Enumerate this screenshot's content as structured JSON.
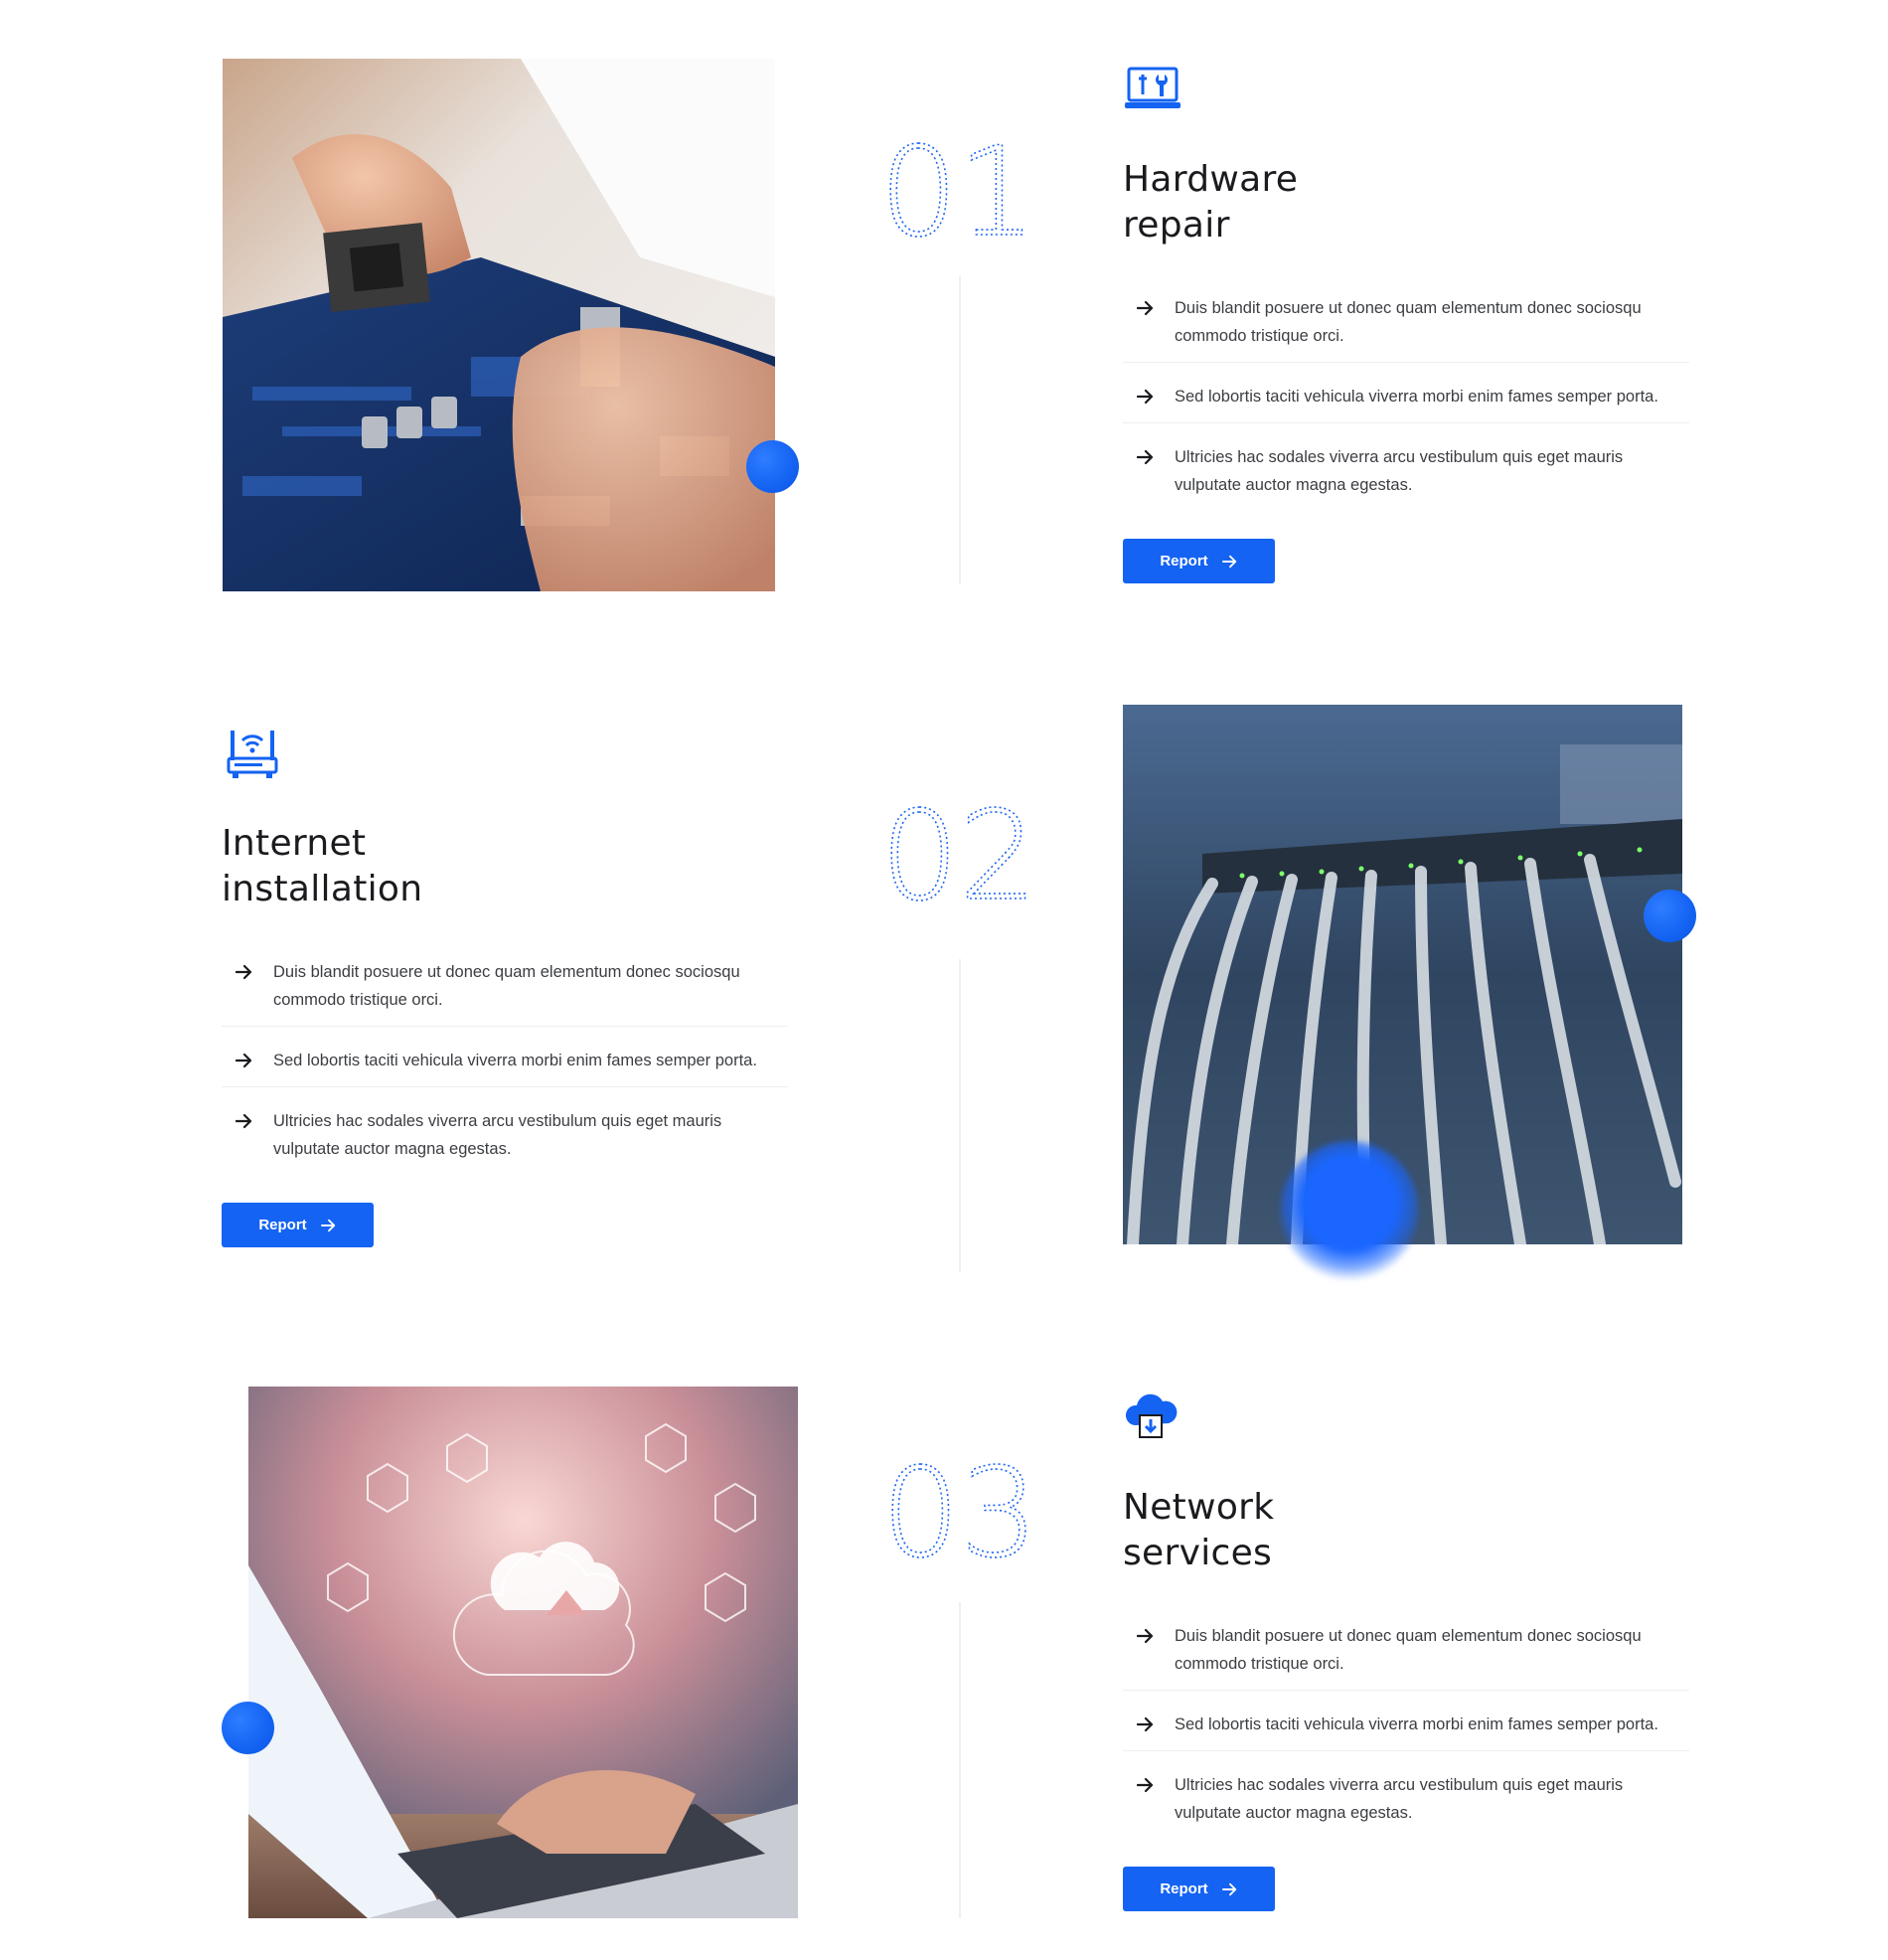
{
  "colors": {
    "accent": "#1463f3",
    "text": "#1b1b1f",
    "muted": "#3b3d42"
  },
  "services": [
    {
      "number": "01",
      "icon": "laptop-repair-icon",
      "title": "Hardware\nrepair",
      "photo": "motherboard-cpu-photo",
      "bullets": [
        "Duis blandit posuere ut donec quam elementum donec sociosqu commodo tristique orci.",
        "Sed lobortis taciti vehicula viverra morbi enim fames semper porta.",
        "Ultricies hac sodales viverra arcu vestibulum quis eget mauris vulputate auctor magna egestas."
      ],
      "button": "Report"
    },
    {
      "number": "02",
      "icon": "wifi-router-icon",
      "title": "Internet\ninstallation",
      "photo": "network-switch-cables-photo",
      "bullets": [
        "Duis blandit posuere ut donec quam elementum donec sociosqu commodo tristique orci.",
        "Sed lobortis taciti vehicula viverra morbi enim fames semper porta.",
        "Ultricies hac sodales viverra arcu vestibulum quis eget mauris vulputate auctor magna egestas."
      ],
      "button": "Report"
    },
    {
      "number": "03",
      "icon": "cloud-download-icon",
      "title": "Network\nservices",
      "photo": "cloud-laptop-photo",
      "bullets": [
        "Duis blandit posuere ut donec quam elementum donec sociosqu commodo tristique orci.",
        "Sed lobortis taciti vehicula viverra morbi enim fames semper porta.",
        "Ultricies hac sodales viverra arcu vestibulum quis eget mauris vulputate auctor magna egestas."
      ],
      "button": "Report"
    }
  ]
}
